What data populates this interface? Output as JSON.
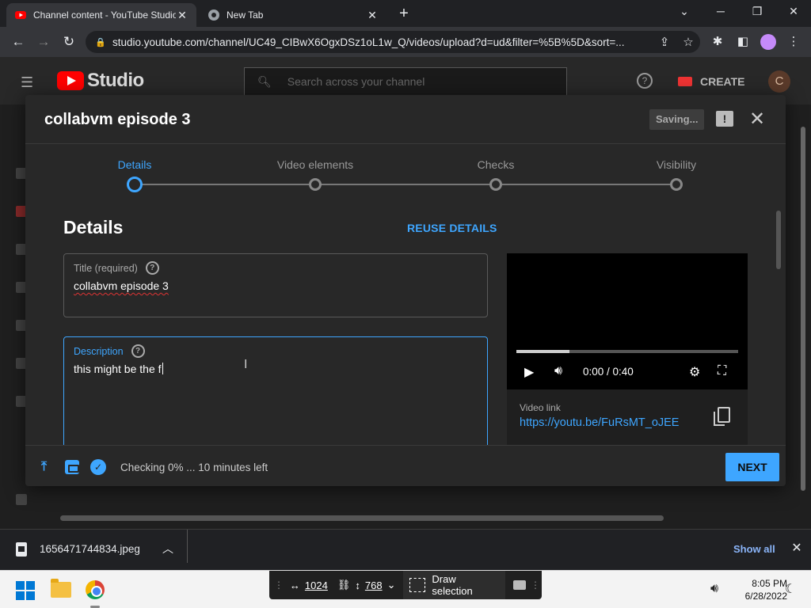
{
  "browser": {
    "tabs": [
      {
        "title": "Channel content - YouTube Studio",
        "close": "✕"
      },
      {
        "title": "New Tab",
        "close": "✕"
      }
    ],
    "new_tab": "+",
    "window_controls": {
      "menu": "⌄",
      "minimize": "─",
      "restore": "❐",
      "close": "✕"
    },
    "url": "studio.youtube.com/channel/UC49_CIBwX6OgxDSz1oL1w_Q/videos/upload?d=ud&filter=%5B%5D&sort=..."
  },
  "studio": {
    "logo_text": "Studio",
    "search_placeholder": "Search across your channel",
    "create_label": "CREATE",
    "avatar_letter": "C"
  },
  "dialog": {
    "title": "collabvm episode 3",
    "saving_label": "Saving...",
    "steps": [
      {
        "label": "Details",
        "active": true
      },
      {
        "label": "Video elements",
        "active": false
      },
      {
        "label": "Checks",
        "active": false
      },
      {
        "label": "Visibility",
        "active": false
      }
    ],
    "section_heading": "Details",
    "reuse_label": "REUSE DETAILS",
    "title_field": {
      "label": "Title (required)",
      "value": "collabvm episode 3"
    },
    "description_field": {
      "label": "Description",
      "value": "this might be the f"
    },
    "help_glyph": "?",
    "player": {
      "time": "0:00 / 0:40",
      "progress": 0.24
    },
    "video_link": {
      "label": "Video link",
      "url": "https://youtu.be/FuRsMT_oJEE"
    },
    "footer": {
      "status": "Checking 0% ... 10 minutes left",
      "next_label": "NEXT"
    }
  },
  "downloads": {
    "file_name": "1656471744834.jpeg",
    "show_all": "Show all"
  },
  "taskbar": {
    "snip": {
      "width": "1024",
      "height": "768",
      "draw_selection": "Draw selection"
    },
    "time": "8:05 PM",
    "date": "6/28/2022"
  },
  "colors": {
    "accent": "#3ea6ff",
    "brand": "#ff0000"
  }
}
